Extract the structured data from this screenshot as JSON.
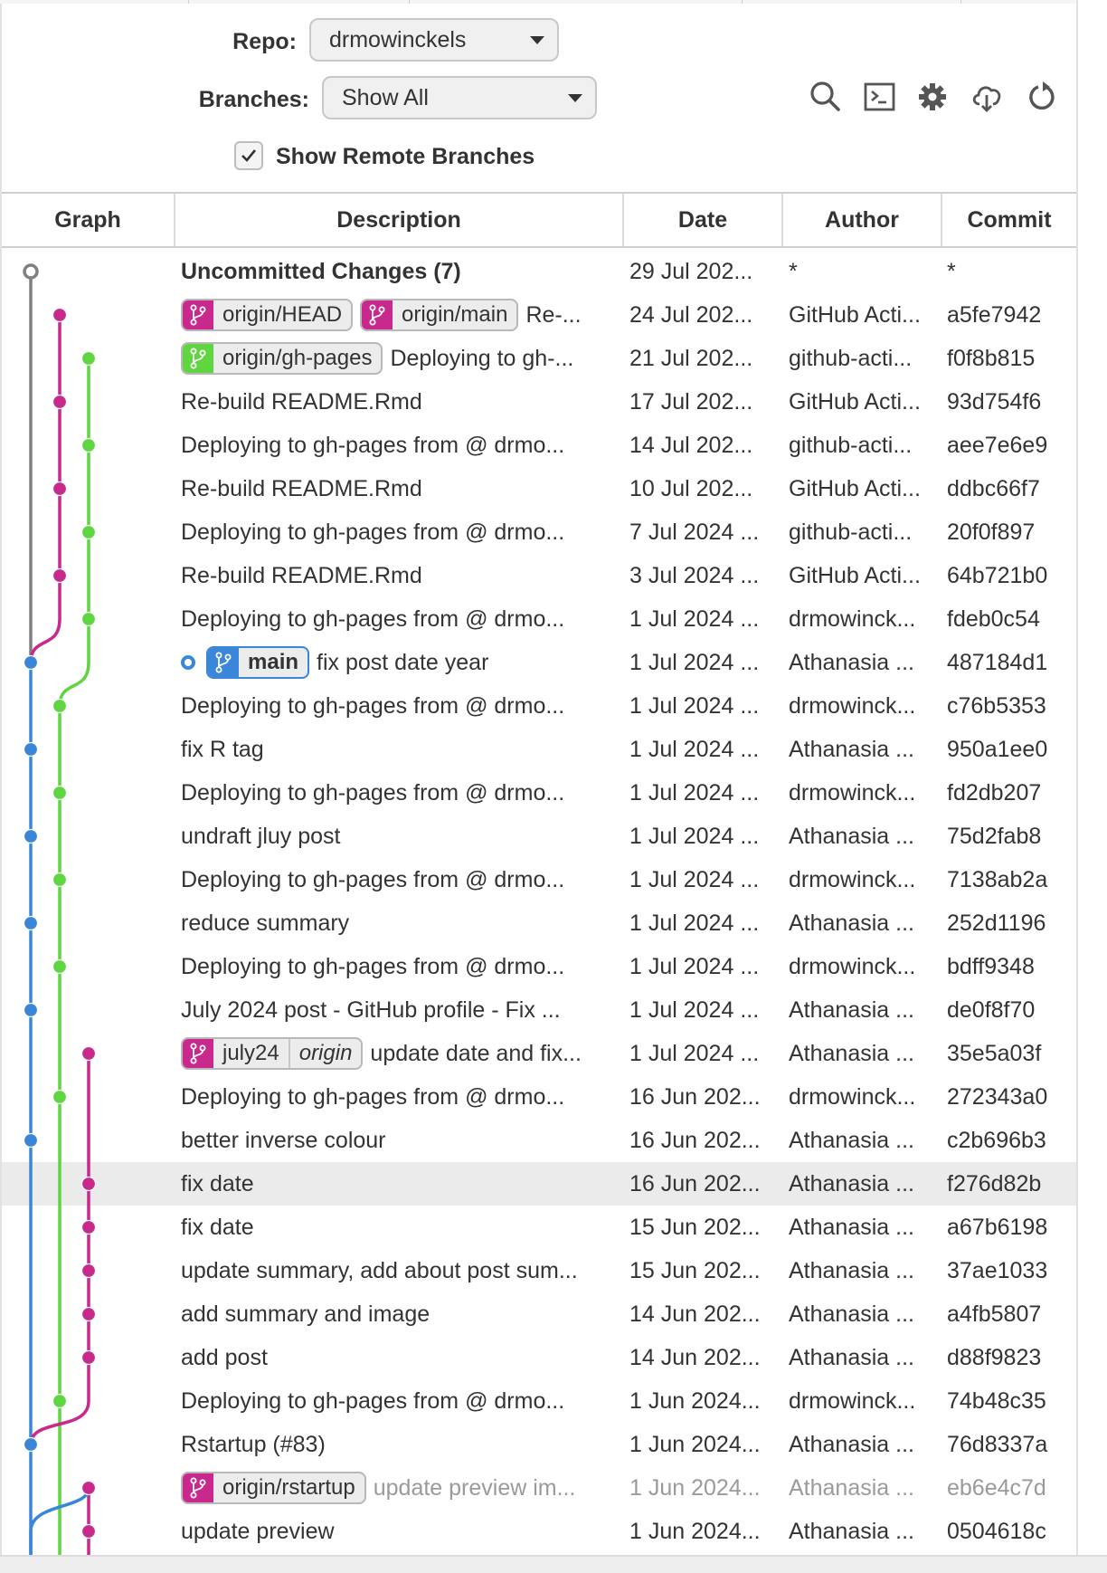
{
  "controls": {
    "repo_label": "Repo:",
    "repo_value": "drmowinckels",
    "branches_label": "Branches:",
    "branches_value": "Show All",
    "show_remote_label": "Show Remote Branches",
    "show_remote_checked": true
  },
  "toolbar": {
    "icons": [
      "search-icon",
      "terminal-icon",
      "gear-icon",
      "cloud-download-icon",
      "refresh-icon"
    ]
  },
  "columns": [
    "Graph",
    "Description",
    "Date",
    "Author",
    "Commit"
  ],
  "colors": {
    "gray": "#808080",
    "magenta": "#c9288c",
    "green": "#5fd53f",
    "blue": "#3a86d8",
    "selected_row": "#ebebeb"
  },
  "commits": [
    {
      "description": "Uncommitted Changes (7)",
      "date": "29 Jul 202...",
      "author": "*",
      "commit": "*",
      "bold": true
    },
    {
      "badges": [
        {
          "name": "origin/HEAD",
          "color": "magenta"
        },
        {
          "name": "origin/main",
          "color": "magenta"
        }
      ],
      "description": "Re-...",
      "date": "24 Jul 202...",
      "author": "GitHub Acti...",
      "commit": "a5fe7942"
    },
    {
      "badges": [
        {
          "name": "origin/gh-pages",
          "color": "green"
        }
      ],
      "description": "Deploying to gh-...",
      "date": "21 Jul 202...",
      "author": "github-acti...",
      "commit": "f0f8b815"
    },
    {
      "description": "Re-build README.Rmd",
      "date": "17 Jul 202...",
      "author": "GitHub Acti...",
      "commit": "93d754f6"
    },
    {
      "description": "Deploying to gh-pages from @ drmo...",
      "date": "14 Jul 202...",
      "author": "github-acti...",
      "commit": "aee7e6e9"
    },
    {
      "description": "Re-build README.Rmd",
      "date": "10 Jul 202...",
      "author": "GitHub Acti...",
      "commit": "ddbc66f7"
    },
    {
      "description": "Deploying to gh-pages from @ drmo...",
      "date": "7 Jul 2024 ...",
      "author": "github-acti...",
      "commit": "20f0f897"
    },
    {
      "description": "Re-build README.Rmd",
      "date": "3 Jul 2024 ...",
      "author": "GitHub Acti...",
      "commit": "64b721b0"
    },
    {
      "description": "Deploying to gh-pages from @ drmo...",
      "date": "1 Jul 2024 ...",
      "author": "drmowinck...",
      "commit": "fdeb0c54"
    },
    {
      "head": true,
      "badges": [
        {
          "name": "main",
          "color": "blue",
          "head": true
        }
      ],
      "description": "fix post date year",
      "date": "1 Jul 2024 ...",
      "author": "Athanasia ...",
      "commit": "487184d1"
    },
    {
      "description": "Deploying to gh-pages from @ drmo...",
      "date": "1 Jul 2024 ...",
      "author": "drmowinck...",
      "commit": "c76b5353"
    },
    {
      "description": "fix R tag",
      "date": "1 Jul 2024 ...",
      "author": "Athanasia ...",
      "commit": "950a1ee0"
    },
    {
      "description": "Deploying to gh-pages from @ drmo...",
      "date": "1 Jul 2024 ...",
      "author": "drmowinck...",
      "commit": "fd2db207"
    },
    {
      "description": "undraft jluy post",
      "date": "1 Jul 2024 ...",
      "author": "Athanasia ...",
      "commit": "75d2fab8"
    },
    {
      "description": "Deploying to gh-pages from @ drmo...",
      "date": "1 Jul 2024 ...",
      "author": "drmowinck...",
      "commit": "7138ab2a"
    },
    {
      "description": "reduce summary",
      "date": "1 Jul 2024 ...",
      "author": "Athanasia ...",
      "commit": "252d1196"
    },
    {
      "description": "Deploying to gh-pages from @ drmo...",
      "date": "1 Jul 2024 ...",
      "author": "drmowinck...",
      "commit": "bdff9348"
    },
    {
      "description": "July 2024 post - GitHub profile - Fix ...",
      "date": "1 Jul 2024 ...",
      "author": "Athanasia ...",
      "commit": "de0f8f70"
    },
    {
      "badges": [
        {
          "name": "july24",
          "color": "magenta",
          "remote": "origin"
        }
      ],
      "description": "update date and fix...",
      "date": "1 Jul 2024 ...",
      "author": "Athanasia ...",
      "commit": "35e5a03f"
    },
    {
      "description": "Deploying to gh-pages from @ drmo...",
      "date": "16 Jun 202...",
      "author": "drmowinck...",
      "commit": "272343a0"
    },
    {
      "description": "better inverse colour",
      "date": "16 Jun 202...",
      "author": "Athanasia ...",
      "commit": "c2b696b3"
    },
    {
      "description": "fix date",
      "date": "16 Jun 202...",
      "author": "Athanasia ...",
      "commit": "f276d82b",
      "selected": true
    },
    {
      "description": "fix date",
      "date": "15 Jun 202...",
      "author": "Athanasia ...",
      "commit": "a67b6198"
    },
    {
      "description": "update summary, add about post sum...",
      "date": "15 Jun 202...",
      "author": "Athanasia ...",
      "commit": "37ae1033"
    },
    {
      "description": "add summary and image",
      "date": "14 Jun 202...",
      "author": "Athanasia ...",
      "commit": "a4fb5807"
    },
    {
      "description": "add post",
      "date": "14 Jun 202...",
      "author": "Athanasia ...",
      "commit": "d88f9823"
    },
    {
      "description": "Deploying to gh-pages from @ drmo...",
      "date": "1 Jun 2024...",
      "author": "drmowinck...",
      "commit": "74b48c35"
    },
    {
      "description": "Rstartup (#83)",
      "date": "1 Jun 2024...",
      "author": "Athanasia ...",
      "commit": "76d8337a"
    },
    {
      "badges": [
        {
          "name": "origin/rstartup",
          "color": "magenta"
        }
      ],
      "description": "update preview im...",
      "date": "1 Jun 2024...",
      "author": "Athanasia ...",
      "commit": "eb6e4c7d",
      "faded": true
    },
    {
      "description": "update preview",
      "date": "1 Jun 2024...",
      "author": "Athanasia ...",
      "commit": "0504618c"
    }
  ],
  "graph": {
    "nodes": [
      {
        "row": 0,
        "lane": 0,
        "color": "gray",
        "hollow": true
      },
      {
        "row": 1,
        "lane": 1,
        "color": "magenta"
      },
      {
        "row": 2,
        "lane": 2,
        "color": "green"
      },
      {
        "row": 3,
        "lane": 1,
        "color": "magenta"
      },
      {
        "row": 4,
        "lane": 2,
        "color": "green"
      },
      {
        "row": 5,
        "lane": 1,
        "color": "magenta"
      },
      {
        "row": 6,
        "lane": 2,
        "color": "green"
      },
      {
        "row": 7,
        "lane": 1,
        "color": "magenta"
      },
      {
        "row": 8,
        "lane": 2,
        "color": "green"
      },
      {
        "row": 9,
        "lane": 0,
        "color": "blue"
      },
      {
        "row": 10,
        "lane": 1,
        "color": "green"
      },
      {
        "row": 11,
        "lane": 0,
        "color": "blue"
      },
      {
        "row": 12,
        "lane": 1,
        "color": "green"
      },
      {
        "row": 13,
        "lane": 0,
        "color": "blue"
      },
      {
        "row": 14,
        "lane": 1,
        "color": "green"
      },
      {
        "row": 15,
        "lane": 0,
        "color": "blue"
      },
      {
        "row": 16,
        "lane": 1,
        "color": "green"
      },
      {
        "row": 17,
        "lane": 0,
        "color": "blue"
      },
      {
        "row": 18,
        "lane": 2,
        "color": "magenta"
      },
      {
        "row": 19,
        "lane": 1,
        "color": "green"
      },
      {
        "row": 20,
        "lane": 0,
        "color": "blue"
      },
      {
        "row": 21,
        "lane": 2,
        "color": "magenta"
      },
      {
        "row": 22,
        "lane": 2,
        "color": "magenta"
      },
      {
        "row": 23,
        "lane": 2,
        "color": "magenta"
      },
      {
        "row": 24,
        "lane": 2,
        "color": "magenta"
      },
      {
        "row": 25,
        "lane": 2,
        "color": "magenta"
      },
      {
        "row": 26,
        "lane": 1,
        "color": "green"
      },
      {
        "row": 27,
        "lane": 0,
        "color": "blue"
      },
      {
        "row": 28,
        "lane": 2,
        "color": "magenta"
      },
      {
        "row": 29,
        "lane": 2,
        "color": "magenta"
      }
    ],
    "edges": [
      {
        "from": [
          0,
          0
        ],
        "to": [
          9,
          0
        ],
        "color": "gray",
        "curve_at_end": true
      },
      {
        "from": [
          1,
          1
        ],
        "to": [
          9,
          0
        ],
        "color": "magenta",
        "curve_at_end": true
      },
      {
        "from": [
          2,
          2
        ],
        "to": [
          10,
          1
        ],
        "color": "green",
        "curve_at_end": true
      },
      {
        "from": [
          9,
          0
        ],
        "to": [
          30,
          0
        ],
        "color": "blue"
      },
      {
        "from": [
          10,
          1
        ],
        "to": [
          30,
          1
        ],
        "color": "green"
      },
      {
        "from": [
          18,
          2
        ],
        "to": [
          27,
          0
        ],
        "color": "magenta",
        "curve_at_end": true
      },
      {
        "from": [
          28,
          2
        ],
        "to": [
          30,
          2
        ],
        "color": "magenta"
      },
      {
        "from": [
          28,
          2
        ],
        "to": [
          30,
          0
        ],
        "color": "blue",
        "curve_at_start": true
      }
    ]
  }
}
